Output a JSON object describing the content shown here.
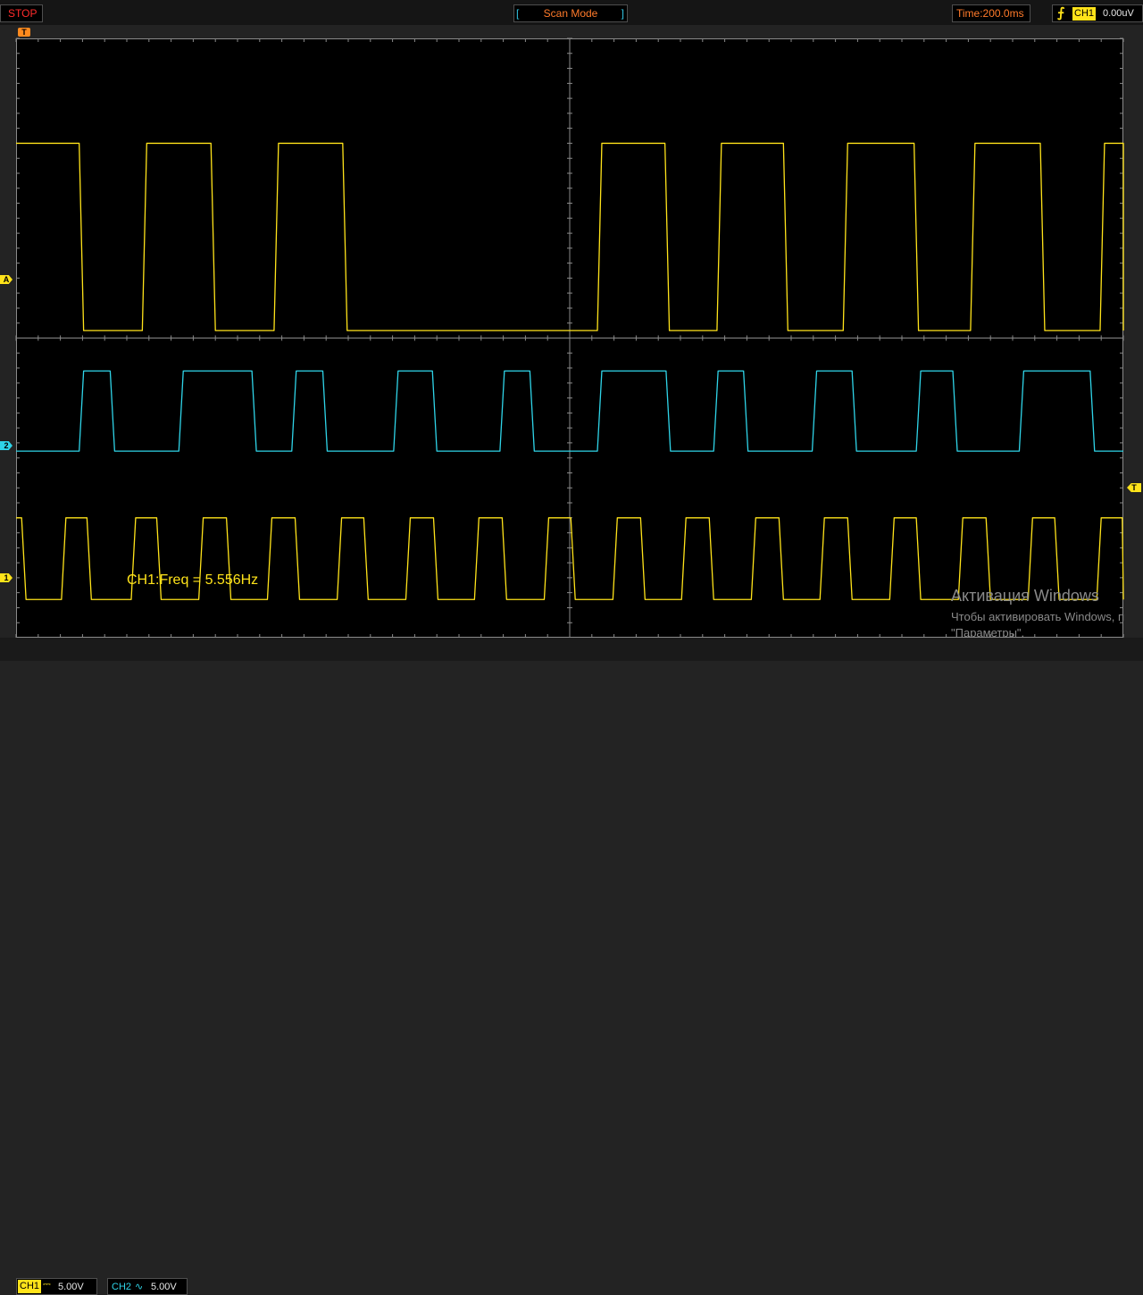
{
  "status": {
    "run_state": "STOP",
    "mode": "Scan Mode",
    "time_base": "Time:200.0ms"
  },
  "trigger": {
    "icon": "rising-edge-icon",
    "channel": "CH1",
    "level": "0.00uV"
  },
  "channels": {
    "ch1": {
      "label": "CH1",
      "coupling_icon": "dc-coupling-icon",
      "scale": "5.00V",
      "color": "#ffe31a"
    },
    "ch2": {
      "label": "CH2",
      "coupling_icon": "ac-coupling-icon",
      "scale": "5.00V",
      "color": "#2fd4e8"
    }
  },
  "markers": {
    "trigger_position": "T",
    "math": "A",
    "ch2": "2",
    "ch1": "1",
    "trigger_level": "T"
  },
  "measurement": "CH1:Freq = 5.556Hz",
  "watermark": {
    "title": "Активация Windows",
    "line1": "Чтобы активировать Windows, п",
    "line2": "\"Параметры\"."
  },
  "colors": {
    "grid": "#8a8a8a",
    "background": "#000000",
    "trigger": "#ff8a1e"
  },
  "chart_data": {
    "type": "line",
    "x_unit": "div",
    "x_range": [
      0,
      10
    ],
    "y_unit": "div",
    "y_range": [
      -4,
      4
    ],
    "series": [
      {
        "name": "A",
        "color": "#ffe31a",
        "high": 2.6,
        "low": 0.1,
        "start_high": true,
        "transitions": [
          0.57,
          1.14,
          1.76,
          2.33,
          2.95,
          5.25,
          5.86,
          6.33,
          6.93,
          7.47,
          8.11,
          8.62,
          9.25,
          9.79,
          10.0
        ]
      },
      {
        "name": "CH2",
        "color": "#2fd4e8",
        "high": -0.44,
        "low": -1.51,
        "start_high": false,
        "transitions": [
          0.57,
          0.85,
          1.47,
          2.13,
          2.49,
          2.77,
          3.41,
          3.76,
          4.37,
          4.64,
          5.25,
          5.87,
          6.3,
          6.57,
          7.19,
          7.55,
          8.13,
          8.46,
          9.06,
          9.7
        ]
      },
      {
        "name": "CH1",
        "color": "#ffe31a",
        "high": -2.4,
        "low": -3.49,
        "start_high": true,
        "transitions": [
          0.05,
          0.41,
          0.64,
          1.04,
          1.27,
          1.65,
          1.9,
          2.27,
          2.52,
          2.9,
          3.14,
          3.52,
          3.77,
          4.14,
          4.39,
          4.77,
          5.01,
          5.39,
          5.64,
          6.01,
          6.26,
          6.64,
          6.89,
          7.26,
          7.51,
          7.89,
          8.13,
          8.51,
          8.76,
          9.14,
          9.38,
          9.76,
          9.99
        ]
      }
    ]
  }
}
